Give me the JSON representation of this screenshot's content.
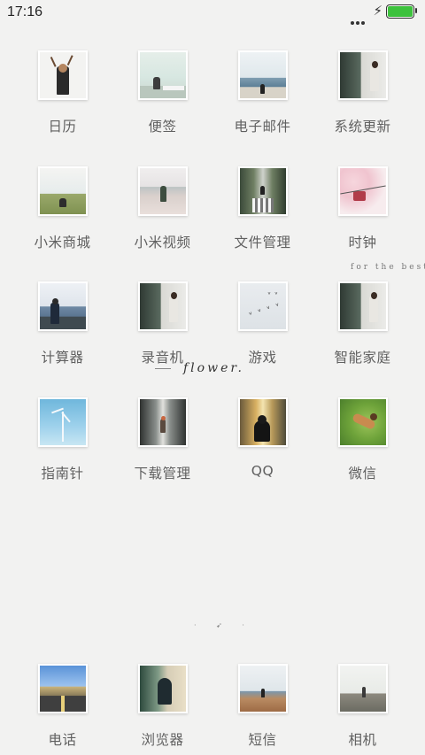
{
  "status_bar": {
    "time": "17:16",
    "battery_level": 1.0,
    "battery_color": "#3dc23d",
    "icons": [
      "more-dots-icon",
      "charging-bolt-icon",
      "battery-icon"
    ]
  },
  "apps": [
    {
      "label": "日历"
    },
    {
      "label": "便签"
    },
    {
      "label": "电子邮件"
    },
    {
      "label": "系统更新"
    },
    {
      "label": "小米商城"
    },
    {
      "label": "小米视频"
    },
    {
      "label": "文件管理"
    },
    {
      "label": "时钟"
    },
    {
      "label": "计算器"
    },
    {
      "label": "录音机"
    },
    {
      "label": "游戏"
    },
    {
      "label": "智能家庭"
    },
    {
      "label": "指南针"
    },
    {
      "label": "下载管理"
    },
    {
      "label": "QQ"
    },
    {
      "label": "微信"
    }
  ],
  "decorations": {
    "flower_text": "flower.",
    "best_text": "for the best o"
  },
  "page_indicator": "· ➹ ·",
  "dock": [
    {
      "label": "电话"
    },
    {
      "label": "浏览器"
    },
    {
      "label": "短信"
    },
    {
      "label": "相机"
    }
  ]
}
